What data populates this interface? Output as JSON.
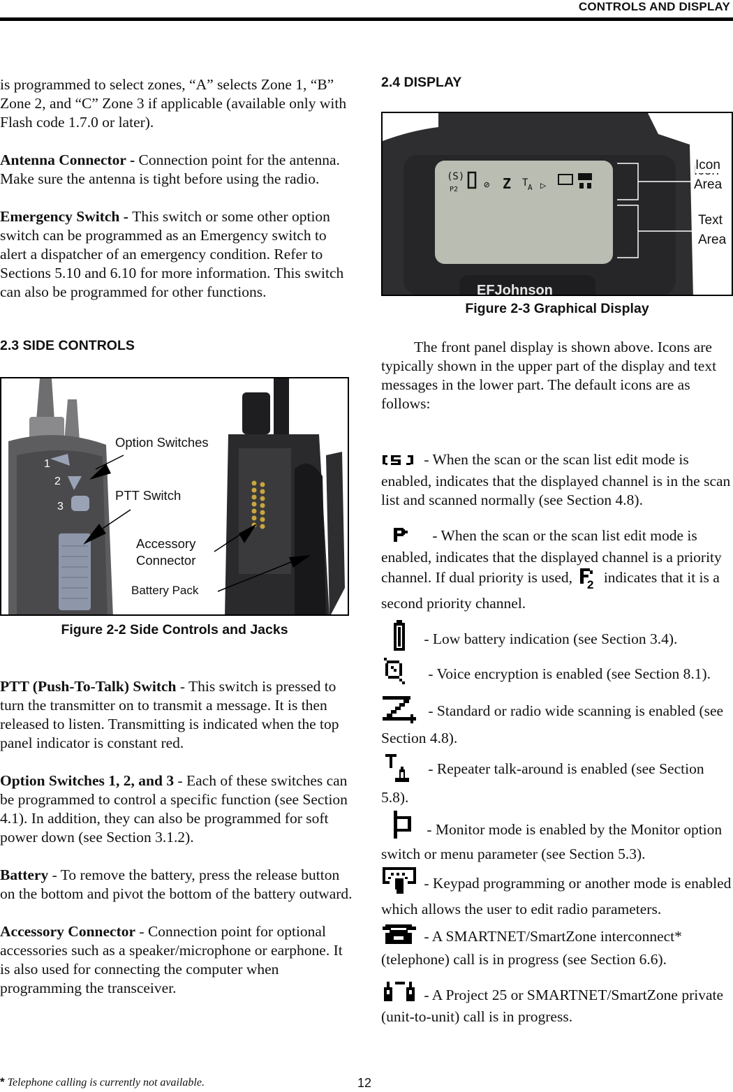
{
  "header": {
    "title": "CONTROLS AND DISPLAY"
  },
  "left": {
    "intro": "is programmed to select zones, “A” selects Zone 1, “B” Zone 2, and “C” Zone 3 if applicable (available only with Flash code 1.7.0 or later).",
    "antenna": {
      "term": "Antenna Connector - ",
      "text": "Connection point for the antenna. Make sure the antenna is tight before using the radio."
    },
    "emergency": {
      "term": "Emergency Switch - ",
      "text": "This switch or some other option switch can be programmed as an Emergency switch to alert a dispatcher of an emergency condition. Refer to Sections 5.10 and 6.10 for more information. This switch can also be programmed for other functions."
    },
    "section_heading": "2.3 SIDE CONTROLS",
    "figure": {
      "caption": "Figure 2-2   Side Controls and Jacks",
      "labels": {
        "option_switches": "Option Switches",
        "ptt_switch": "PTT Switch",
        "accessory_line1": "Accessory",
        "accessory_line2": "Connector",
        "battery_pack": "Battery Pack",
        "n1": "1",
        "n2": "2",
        "n3": "3"
      }
    },
    "ptt": {
      "term": "PTT (Push-To-Talk) Switch",
      "text": " - This switch is pressed to turn the transmitter on to transmit a message. It is then released to listen. Transmitting is indicated when the top panel indicator is constant red."
    },
    "option": {
      "term": "Option Switches 1, 2, and 3",
      "text": " - Each of these switches can be programmed to control a specific function (see Section 4.1). In addition, they can also be programmed for soft power down (see Section 3.1.2)."
    },
    "battery": {
      "term": "Battery",
      "text": " - To remove the battery, press the release button on the bottom and pivot the bottom of the battery outward."
    },
    "accessory": {
      "term": "Accessory Connector",
      "text": " - Connection point for optional accessories such as a speaker/microphone or earphone. It is also used for connecting the computer when programming the transceiver."
    }
  },
  "right": {
    "section_heading": "2.4 DISPLAY",
    "figure": {
      "caption": "Figure 2-3   Graphical Display",
      "labels": {
        "icon_l1": "Icon",
        "icon_l2": "Area",
        "text_l1": "Text",
        "text_l2": "Area",
        "brand": "EFJohnson"
      }
    },
    "intro": "The front panel display is shown above. Icons are typically shown in the upper part of the display and text messages in the lower part. The default icons are as follows:",
    "icons": [
      {
        "icon": "scan-list-icon",
        "text": " - When the scan or the scan list edit mode is enabled, indicates that the displayed channel is in the scan list and scanned normally (see Section 4.8)."
      },
      {
        "icon": "priority-icon",
        "text_a": "  - When the scan or the scan list edit mode is enabled, indicates that the displayed channel is a priority channel. If dual priority is used, ",
        "text_b": " indicates that it is a second priority channel."
      },
      {
        "icon": "low-battery-icon",
        "text": "  - Low battery indication (see Section 3.4)."
      },
      {
        "icon": "voice-encryption-icon",
        "text": " - Voice encryption is enabled (see Section 8.1)."
      },
      {
        "icon": "scanning-icon",
        "text": " - Standard or radio wide scanning is enabled (see Section 4.8)."
      },
      {
        "icon": "talkaround-icon",
        "text": " - Repeater talk-around is enabled (see Section 5.8)."
      },
      {
        "icon": "monitor-icon",
        "text": "  - Monitor mode is enabled by the Monitor option switch or menu parameter (see Section 5.3)."
      },
      {
        "icon": "keypad-programming-icon",
        "text": " - Keypad programming or another mode is enabled which allows the user to edit radio parameters."
      },
      {
        "icon": "telephone-icon",
        "text": " - A SMARTNET/SmartZone interconnect* (telephone) call is in progress (see Section 6.6)."
      },
      {
        "icon": "private-call-icon",
        "text": " - A Project 25 or SMARTNET/SmartZone private (unit-to-unit) call is in progress."
      }
    ]
  },
  "footer": {
    "star": "*",
    "footnote": " Telephone calling is currently not available.",
    "page_number": "12"
  }
}
